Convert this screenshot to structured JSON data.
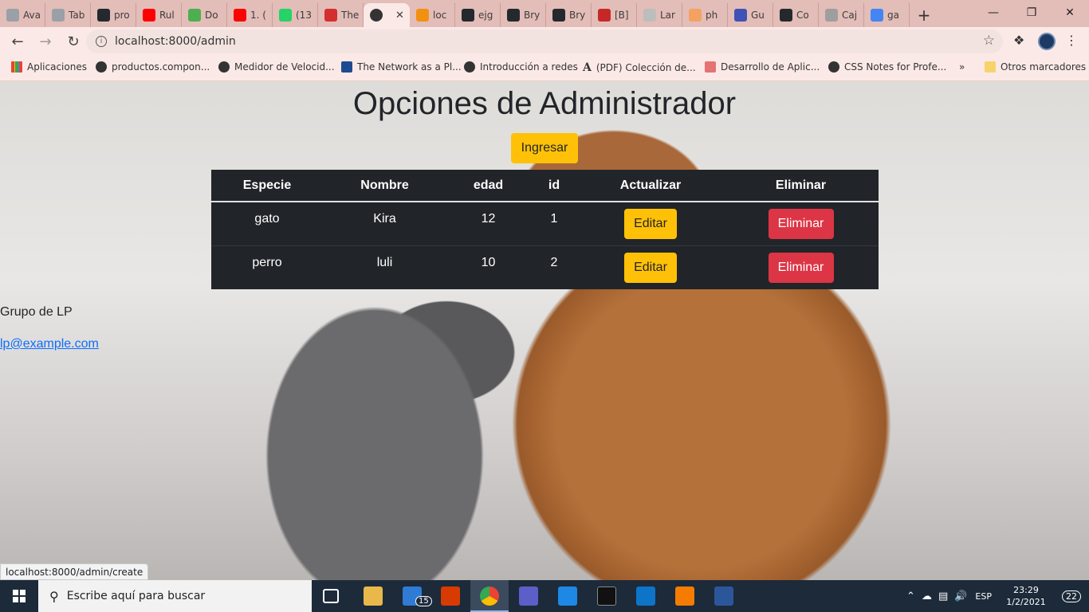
{
  "browser": {
    "tabs": [
      {
        "label": "Ava",
        "color": "#9aa0a6"
      },
      {
        "label": "Tab",
        "color": "#9aa0a6"
      },
      {
        "label": "pro",
        "color": "#24292e"
      },
      {
        "label": "Rul",
        "color": "#ff0000"
      },
      {
        "label": "Do",
        "color": "#4caf50"
      },
      {
        "label": "1. (",
        "color": "#ff0000"
      },
      {
        "label": "(13",
        "color": "#25d366"
      },
      {
        "label": "The",
        "color": "#d32f2f"
      },
      {
        "label": "",
        "color": "#333333",
        "active": true
      },
      {
        "label": "loc",
        "color": "#f29111"
      },
      {
        "label": "ejg",
        "color": "#24292e"
      },
      {
        "label": "Bry",
        "color": "#24292e"
      },
      {
        "label": "Bry",
        "color": "#24292e"
      },
      {
        "label": "[B]",
        "color": "#c62828"
      },
      {
        "label": "Lar",
        "color": "#bdbdbd"
      },
      {
        "label": "ph",
        "color": "#f4a261"
      },
      {
        "label": "Gu",
        "color": "#3f51b5"
      },
      {
        "label": "Co",
        "color": "#24292e"
      },
      {
        "label": "Caj",
        "color": "#9e9e9e"
      },
      {
        "label": "ga",
        "color": "#4285f4"
      }
    ],
    "url": "localhost:8000/admin",
    "bookmarks": [
      {
        "label": "Aplicaciones",
        "icon": "apps-grid-icon"
      },
      {
        "label": "productos.compon...",
        "icon": "globe-icon"
      },
      {
        "label": "Medidor de Velocid...",
        "icon": "globe-icon"
      },
      {
        "label": "The Network as a Pl...",
        "icon": "cp-icon"
      },
      {
        "label": "Introducción a redes",
        "icon": "globe-icon"
      },
      {
        "label": "(PDF) Colección de...",
        "icon": "academia-icon"
      },
      {
        "label": "Desarrollo de Aplic...",
        "icon": "app-icon"
      },
      {
        "label": "CSS Notes for Profe...",
        "icon": "globe-icon"
      },
      {
        "label": "»",
        "icon": ""
      },
      {
        "label": "Otros marcadores",
        "icon": "folder-icon"
      }
    ],
    "status_url": "localhost:8000/admin/create"
  },
  "page": {
    "title": "Opciones de Administrador",
    "ingresar_label": "Ingresar",
    "table": {
      "headers": [
        "Especie",
        "Nombre",
        "edad",
        "id",
        "Actualizar",
        "Eliminar"
      ],
      "rows": [
        {
          "especie": "gato",
          "nombre": "Kira",
          "edad": "12",
          "id": "1",
          "edit_label": "Editar",
          "delete_label": "Eliminar"
        },
        {
          "especie": "perro",
          "nombre": "luli",
          "edad": "10",
          "id": "2",
          "edit_label": "Editar",
          "delete_label": "Eliminar"
        }
      ]
    },
    "footer": {
      "group": "Grupo de LP",
      "email": "lp@example.com"
    }
  },
  "taskbar": {
    "search_placeholder": "Escribe aquí para buscar",
    "mail_badge": "15",
    "language": "ESP",
    "time": "23:29",
    "date": "1/2/2021",
    "notifications": "22"
  },
  "colors": {
    "warning": "#ffc107",
    "danger": "#dc3545",
    "table_dark": "#212529",
    "link": "#0d6efd"
  }
}
